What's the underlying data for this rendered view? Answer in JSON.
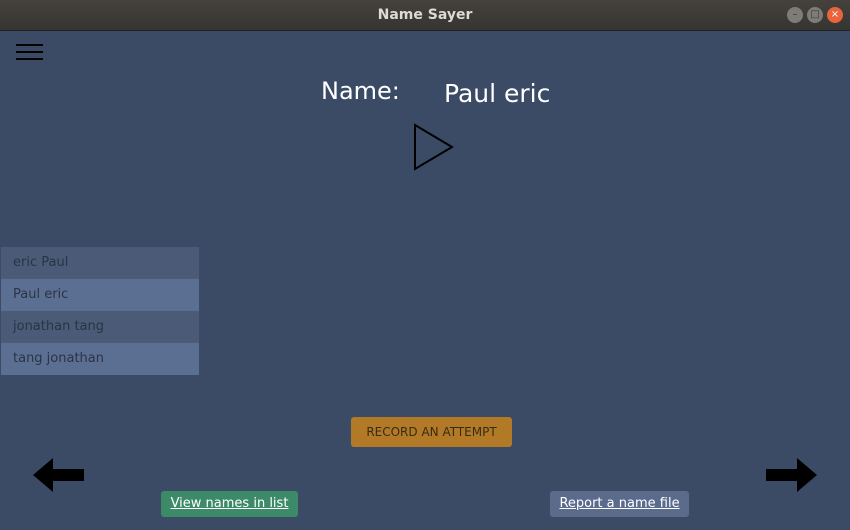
{
  "window": {
    "title": "Name Sayer",
    "controls": [
      "–",
      "□",
      "×"
    ]
  },
  "header": {
    "name_label": "Name:",
    "current_name": "Paul eric"
  },
  "names_list": [
    {
      "label": "eric Paul"
    },
    {
      "label": "Paul eric"
    },
    {
      "label": "jonathan tang"
    },
    {
      "label": "tang jonathan"
    }
  ],
  "buttons": {
    "record": "RECORD AN ATTEMPT",
    "view_list": "View names in list",
    "report": "Report a name file"
  },
  "icons": {
    "menu": "hamburger-menu-icon",
    "play": "play-icon",
    "prev": "arrow-left-icon",
    "next": "arrow-right-icon"
  },
  "colors": {
    "background": "#3b4b66",
    "record_button": "#b27a27",
    "view_list_button": "#3c8a68",
    "report_button": "#5a6b8c"
  }
}
